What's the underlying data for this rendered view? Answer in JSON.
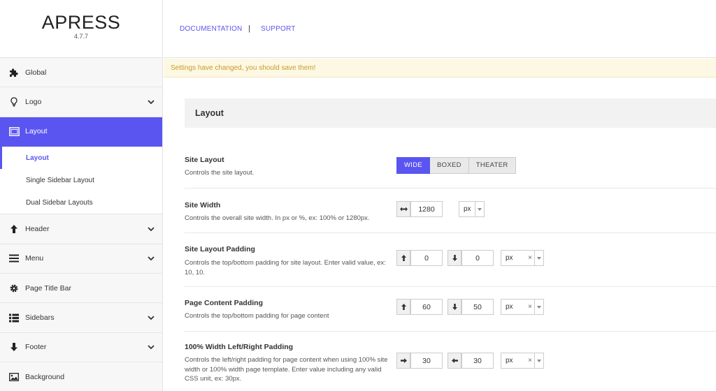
{
  "brand": {
    "name": "APRESS",
    "version": "4.7.7"
  },
  "topbar": {
    "documentation": "DOCUMENTATION",
    "separator": "|",
    "support": "SUPPORT"
  },
  "notice": "Settings have changed, you should save them!",
  "sidebar": {
    "items": [
      {
        "label": "Global",
        "icon": "puzzle-icon",
        "expandable": false
      },
      {
        "label": "Logo",
        "icon": "lightbulb-icon",
        "expandable": true
      },
      {
        "label": "Layout",
        "icon": "window-icon",
        "expandable": false,
        "active": true
      },
      {
        "label": "Header",
        "icon": "arrow-up-icon",
        "expandable": true
      },
      {
        "label": "Menu",
        "icon": "hamburger-icon",
        "expandable": true
      },
      {
        "label": "Page Title Bar",
        "icon": "gear-icon",
        "expandable": false
      },
      {
        "label": "Sidebars",
        "icon": "list-icon",
        "expandable": true
      },
      {
        "label": "Footer",
        "icon": "arrow-down-icon",
        "expandable": true
      },
      {
        "label": "Background",
        "icon": "image-icon",
        "expandable": false
      }
    ],
    "layout_sub": [
      "Layout",
      "Single Sidebar Layout",
      "Dual Sidebar Layouts"
    ]
  },
  "section": {
    "title": "Layout"
  },
  "options": {
    "site_layout": {
      "title": "Site Layout",
      "desc": "Controls the site layout.",
      "buttons": [
        "WIDE",
        "BOXED",
        "THEATER"
      ],
      "selected": "WIDE"
    },
    "site_width": {
      "title": "Site Width",
      "desc": "Controls the overall site width. In px or %, ex: 100% or 1280px.",
      "value": "1280",
      "unit": "px"
    },
    "site_layout_padding": {
      "title": "Site Layout Padding",
      "desc": "Controls the top/bottom padding for site layout. Enter valid value, ex: 10, 10.",
      "top": "0",
      "bottom": "0",
      "unit": "px",
      "clear": "×"
    },
    "page_content_padding": {
      "title": "Page Content Padding",
      "desc": "Controls the top/bottom padding for page content",
      "top": "60",
      "bottom": "50",
      "unit": "px",
      "clear": "×"
    },
    "full_width_padding": {
      "title": "100% Width Left/Right Padding",
      "desc": "Controls the left/right padding for page content when using 100% site width or 100% width page template. Enter value including any valid CSS unit, ex: 30px.",
      "right": "30",
      "left": "30",
      "unit": "px",
      "clear": "×"
    }
  },
  "colors": {
    "accent": "#5a55f0",
    "notice_bg": "#fcf8e3",
    "notice_text": "#c99a2e"
  }
}
